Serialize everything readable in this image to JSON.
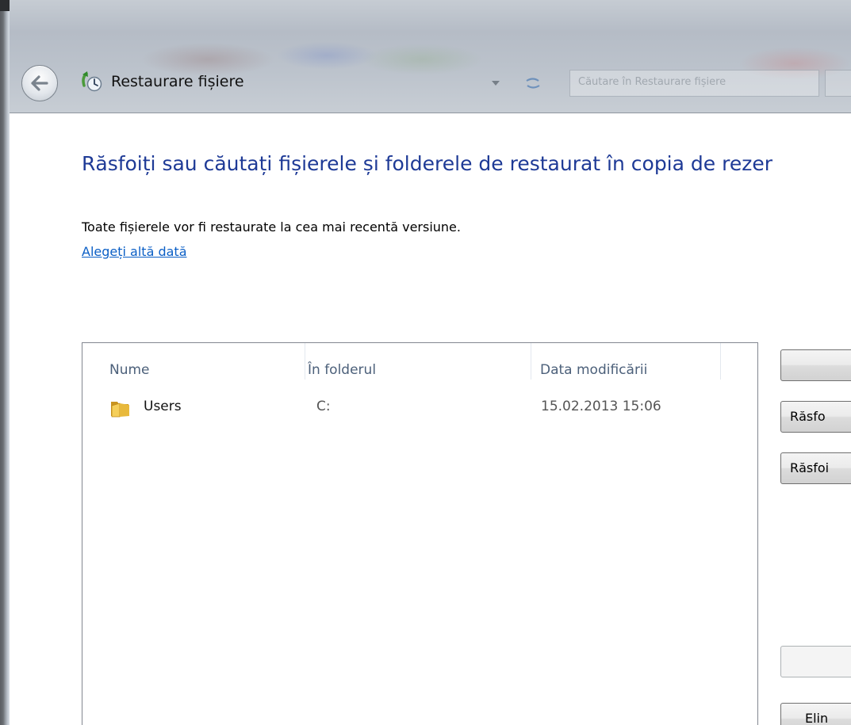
{
  "window": {
    "title": "Restaurare fișiere",
    "search_placeholder": "Căutare în Restaurare fișiere"
  },
  "content": {
    "heading": "Răsfoiți sau căutați fișierele și folderele de restaurat în copia de rezer",
    "info": "Toate fișierele vor fi restaurate la cea mai recentă versiune.",
    "choose_date_link": "Alegeți altă dată"
  },
  "file_list": {
    "columns": [
      "Nume",
      "În folderul",
      "Data modificării"
    ],
    "rows": [
      {
        "name": "Users",
        "folder": "C:",
        "modified": "15.02.2013 15:06"
      }
    ]
  },
  "buttons": {
    "search_label": "",
    "browse_files_label": "Răsfo",
    "browse_folders_label": "Răsfoi",
    "remove_label": "",
    "remove_all_label": "Elin"
  },
  "colors": {
    "heading": "#1e3a96",
    "link": "#0b5fc6",
    "column_header": "#4c607a"
  }
}
